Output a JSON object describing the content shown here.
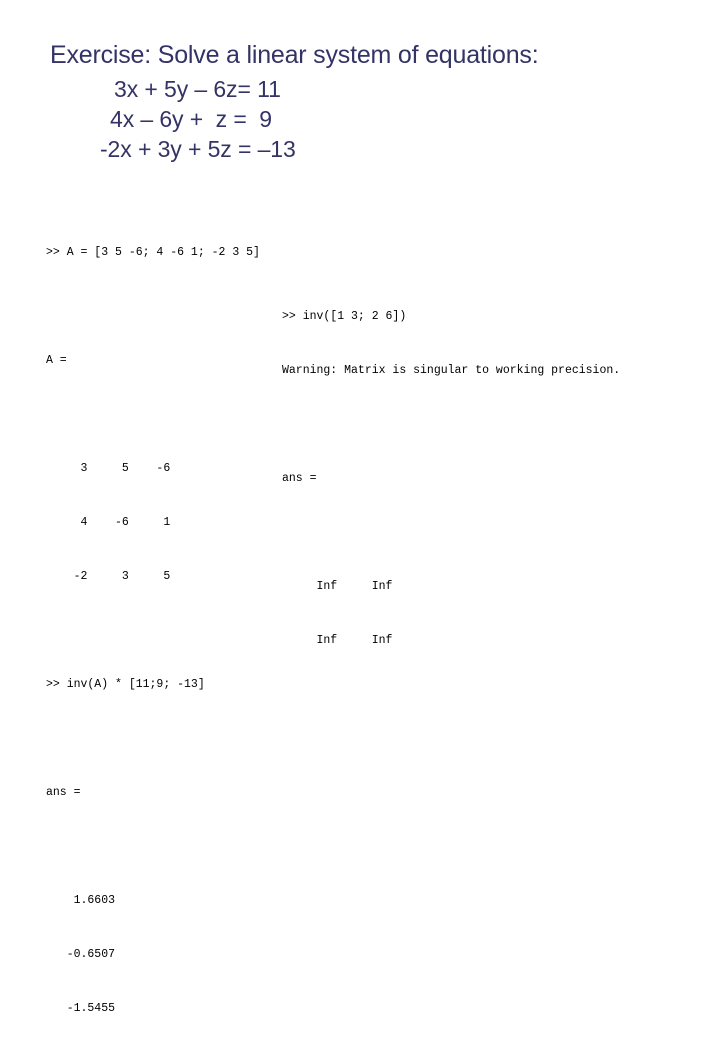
{
  "slide": {
    "title": "Exercise: Solve a linear system of equations:",
    "equations": [
      "3x + 5y – 6z= 11",
      "4x – 6y +  z =  9",
      "-2x + 3y + 5z = –13"
    ],
    "title_color": "#333366"
  },
  "console_left": {
    "command_define": ">> A = [3 5 -6; 4 -6 1; -2 3 5]",
    "result_label": "A =",
    "matrix_rows": [
      "     3     5    -6",
      "     4    -6     1",
      "    -2     3     5"
    ],
    "command_solve": ">> inv(A) * [11;9; -13]",
    "answer_label": "ans =",
    "answer_rows": [
      "    1.6603",
      "   -0.6507",
      "   -1.5455"
    ]
  },
  "console_right": {
    "command_inv": ">> inv([1 3; 2 6])",
    "warning": "Warning: Matrix is singular to working precision.",
    "answer_label": "ans =",
    "answer_rows": [
      "     Inf     Inf",
      "     Inf     Inf"
    ]
  }
}
